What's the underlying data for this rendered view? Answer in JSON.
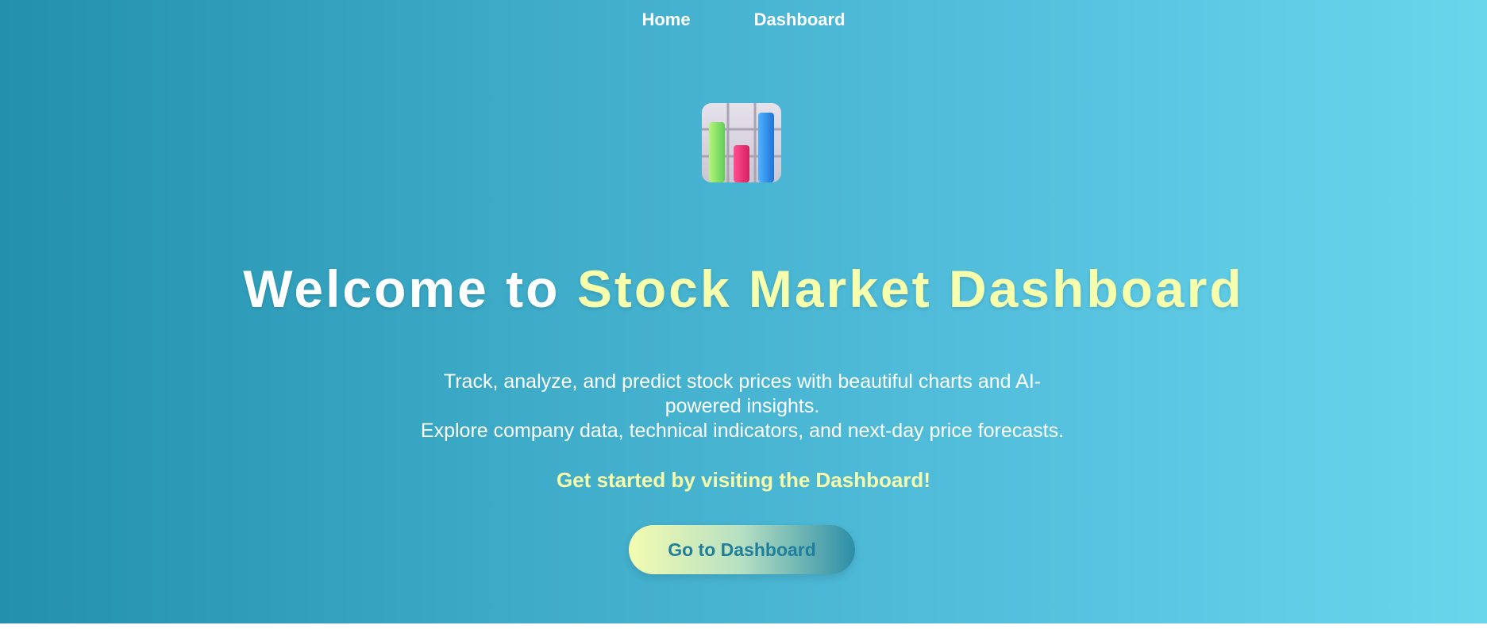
{
  "nav": {
    "items": [
      {
        "label": "Home"
      },
      {
        "label": "Dashboard"
      }
    ]
  },
  "hero": {
    "icon": "bar-chart-icon",
    "title_prefix": "Welcome to ",
    "title_accent": "Stock Market Dashboard",
    "description_line1": "Track, analyze, and predict stock prices with beautiful charts and AI-powered insights.",
    "description_line2": "Explore company data, technical indicators, and next-day price forecasts.",
    "cta_text": "Get started by visiting the Dashboard!",
    "button_label": "Go to Dashboard"
  },
  "colors": {
    "accent": "#f6ffab",
    "background_start": "#2291ad",
    "background_end": "#6ad6ec"
  }
}
